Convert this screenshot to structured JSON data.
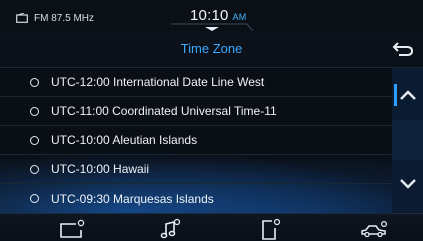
{
  "status_bar": {
    "radio": "FM 87.5 MHz",
    "time": "10:10",
    "ampm": "AM"
  },
  "header": {
    "title": "Time Zone"
  },
  "time_zones": [
    "UTC-12:00 International Date Line West",
    "UTC-11:00 Coordinated Universal Time-11",
    "UTC-10:00 Aleutian Islands",
    "UTC-10:00 Hawaii",
    "UTC-09:30 Marquesas Islands"
  ],
  "icons": {
    "radio": "radio-icon",
    "back": "back-arrow-icon",
    "scroll_up": "chevron-up-icon",
    "scroll_down": "chevron-down-icon",
    "nav": [
      "display-settings-icon",
      "sound-settings-icon",
      "phone-settings-icon",
      "vehicle-settings-icon"
    ]
  },
  "colors": {
    "accent": "#39a9ff",
    "background": "#0a0e15",
    "text": "#eef3f8"
  }
}
